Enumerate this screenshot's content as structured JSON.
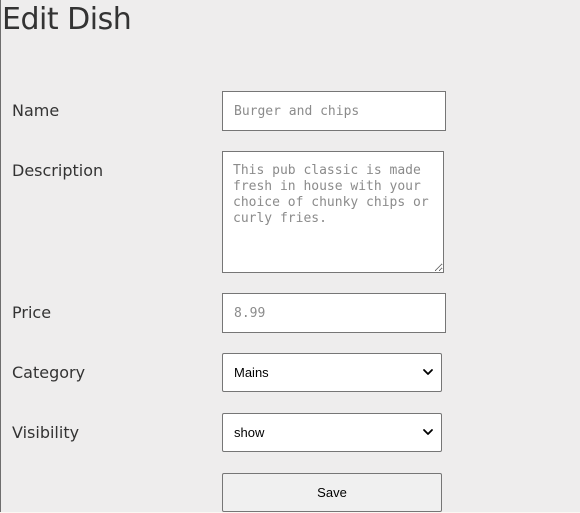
{
  "page": {
    "title": "Edit Dish"
  },
  "form": {
    "name": {
      "label": "Name",
      "placeholder": "Burger and chips"
    },
    "description": {
      "label": "Description",
      "placeholder": "This pub classic is made fresh in house with your choice of chunky chips or curly fries."
    },
    "price": {
      "label": "Price",
      "placeholder": "8.99"
    },
    "category": {
      "label": "Category",
      "selected": "Mains",
      "icon": "chevron-down-icon"
    },
    "visibility": {
      "label": "Visibility",
      "selected": "show",
      "icon": "chevron-down-icon"
    },
    "save_label": "Save"
  }
}
